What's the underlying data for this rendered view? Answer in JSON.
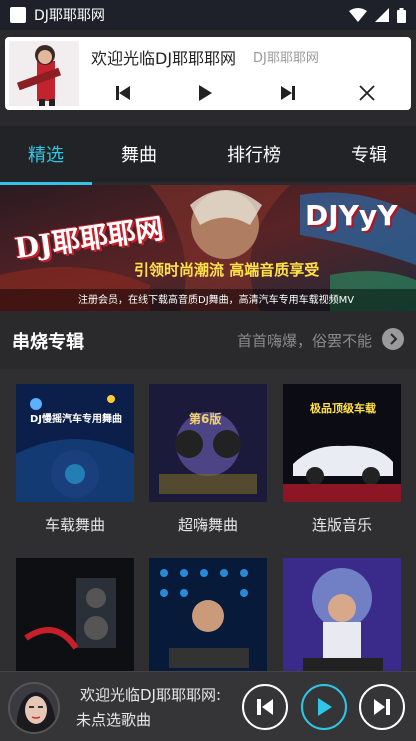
{
  "status_bar": {
    "app_title": "DJ耶耶耶网"
  },
  "notification": {
    "title": "欢迎光临DJ耶耶耶网",
    "subtitle": "DJ耶耶耶网"
  },
  "tabs": [
    {
      "label": "精选",
      "active": true
    },
    {
      "label": "舞曲",
      "active": false
    },
    {
      "label": "排行榜",
      "active": false
    },
    {
      "label": "专辑",
      "active": false
    }
  ],
  "banner": {
    "brand": "DJ耶耶耶网",
    "logo": "DJYyY",
    "slogan": "引领时尚潮流 高端音质享受",
    "caption": "注册会员，在线下载高音质DJ舞曲，高清汽车专用车载视频MV"
  },
  "section": {
    "title": "串烧专辑",
    "more": "首首嗨爆，俗罢不能"
  },
  "albums": [
    {
      "label": "车载舞曲",
      "cover_text": "DJ慢摇汽车专用舞曲"
    },
    {
      "label": "超嗨舞曲",
      "cover_text": "第6版"
    },
    {
      "label": "连版音乐",
      "cover_text": "极品顶级车载"
    },
    {
      "label": "",
      "cover_text": ""
    },
    {
      "label": "",
      "cover_text": ""
    },
    {
      "label": "",
      "cover_text": ""
    }
  ],
  "player": {
    "title": "欢迎光临DJ耶耶耶网:",
    "subtitle": "未点选歌曲"
  },
  "colors": {
    "accent": "#2fc7e8",
    "tab_bg": "#222326",
    "page_bg": "#2a2a2c"
  }
}
